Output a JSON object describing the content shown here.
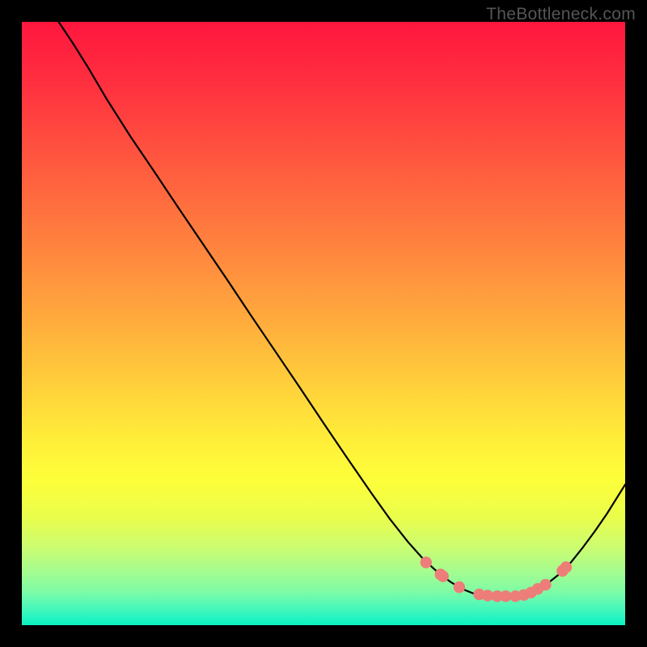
{
  "watermark": "TheBottleneck.com",
  "gradient": {
    "stops": [
      {
        "offset": 0.0,
        "color": "#ff163e"
      },
      {
        "offset": 0.1,
        "color": "#ff2f3f"
      },
      {
        "offset": 0.2,
        "color": "#ff4e3f"
      },
      {
        "offset": 0.3,
        "color": "#ff6d3f"
      },
      {
        "offset": 0.4,
        "color": "#ff8c3e"
      },
      {
        "offset": 0.5,
        "color": "#ffad3d"
      },
      {
        "offset": 0.6,
        "color": "#ffcf3b"
      },
      {
        "offset": 0.7,
        "color": "#fff039"
      },
      {
        "offset": 0.76,
        "color": "#fdff3a"
      },
      {
        "offset": 0.82,
        "color": "#eafd4b"
      },
      {
        "offset": 0.87,
        "color": "#ccfd71"
      },
      {
        "offset": 0.91,
        "color": "#a6fc8e"
      },
      {
        "offset": 0.943,
        "color": "#80fca5"
      },
      {
        "offset": 0.962,
        "color": "#5cf9b4"
      },
      {
        "offset": 0.978,
        "color": "#3bf6bd"
      },
      {
        "offset": 0.99,
        "color": "#1ef4c1"
      },
      {
        "offset": 1.0,
        "color": "#09f3c0"
      }
    ]
  },
  "chart_data": {
    "type": "line",
    "title": "",
    "xlabel": "",
    "ylabel": "",
    "x_range": [
      0,
      100
    ],
    "y_range": [
      0,
      100
    ],
    "curve_normalized_xy": [
      [
        0.061,
        0.0
      ],
      [
        0.085,
        0.036
      ],
      [
        0.11,
        0.076
      ],
      [
        0.14,
        0.127
      ],
      [
        0.18,
        0.19
      ],
      [
        0.22,
        0.249
      ],
      [
        0.26,
        0.309
      ],
      [
        0.3,
        0.368
      ],
      [
        0.34,
        0.427
      ],
      [
        0.38,
        0.487
      ],
      [
        0.42,
        0.546
      ],
      [
        0.46,
        0.605
      ],
      [
        0.5,
        0.665
      ],
      [
        0.54,
        0.724
      ],
      [
        0.58,
        0.782
      ],
      [
        0.61,
        0.824
      ],
      [
        0.64,
        0.862
      ],
      [
        0.665,
        0.89
      ],
      [
        0.69,
        0.913
      ],
      [
        0.71,
        0.928
      ],
      [
        0.73,
        0.94
      ],
      [
        0.75,
        0.948
      ],
      [
        0.77,
        0.952
      ],
      [
        0.79,
        0.953
      ],
      [
        0.81,
        0.953
      ],
      [
        0.83,
        0.95
      ],
      [
        0.85,
        0.943
      ],
      [
        0.87,
        0.932
      ],
      [
        0.89,
        0.916
      ],
      [
        0.91,
        0.896
      ],
      [
        0.93,
        0.871
      ],
      [
        0.95,
        0.844
      ],
      [
        0.97,
        0.815
      ],
      [
        0.99,
        0.783
      ],
      [
        1.0,
        0.767
      ]
    ],
    "markers_normalized_xy": [
      [
        0.67,
        0.896
      ],
      [
        0.694,
        0.916
      ],
      [
        0.698,
        0.919
      ],
      [
        0.725,
        0.937
      ],
      [
        0.758,
        0.949
      ],
      [
        0.772,
        0.951
      ],
      [
        0.788,
        0.952
      ],
      [
        0.802,
        0.952
      ],
      [
        0.818,
        0.952
      ],
      [
        0.832,
        0.95
      ],
      [
        0.844,
        0.946
      ],
      [
        0.855,
        0.94
      ],
      [
        0.868,
        0.933
      ],
      [
        0.896,
        0.91
      ],
      [
        0.902,
        0.904
      ]
    ],
    "marker_color": "#ed7d79",
    "curve_color": "#000000"
  }
}
